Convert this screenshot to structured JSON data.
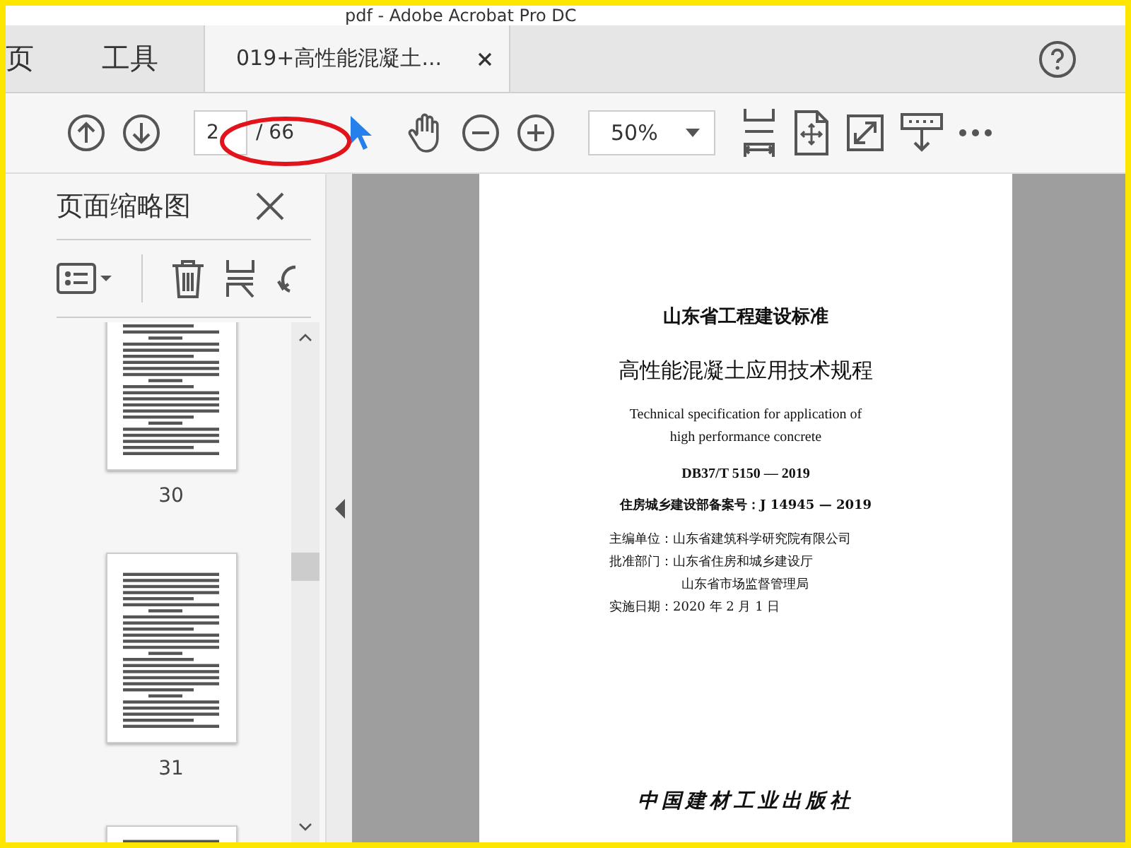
{
  "window": {
    "title": "pdf - Adobe Acrobat Pro DC"
  },
  "tabs": [
    {
      "label": "页",
      "selected": false
    },
    {
      "label": "工具",
      "selected": false
    },
    {
      "label": "019+高性能混凝土...",
      "selected": true
    }
  ],
  "toolbar": {
    "page_number": "2",
    "page_total": "/ 66",
    "zoom": "50%"
  },
  "sidebar": {
    "title": "页面缩略图",
    "thumbnails": [
      {
        "page": "30"
      },
      {
        "page": "31"
      }
    ]
  },
  "document": {
    "lines": [
      {
        "kind": "series",
        "text": "山东省工程建设标准"
      },
      {
        "kind": "title",
        "text": "高性能混凝土应用技术规程"
      },
      {
        "kind": "english",
        "text": "Technical specification for application of"
      },
      {
        "kind": "english",
        "text": "high performance concrete"
      },
      {
        "kind": "code",
        "text": "DB37/T 5150 — 2019"
      },
      {
        "kind": "record",
        "text": "住房城乡建设部备案号：J 14945 — 2019"
      },
      {
        "kind": "meta",
        "text": "主编单位：山东省建筑科学研究院有限公司"
      },
      {
        "kind": "meta",
        "text": "批准部门：山东省住房和城乡建设厅"
      },
      {
        "kind": "meta-indent",
        "text": "山东省市场监督管理局"
      },
      {
        "kind": "meta",
        "text": "实施日期：2020 年 2 月 1 日"
      },
      {
        "kind": "publisher",
        "text": "中国建材工业出版社"
      }
    ]
  }
}
